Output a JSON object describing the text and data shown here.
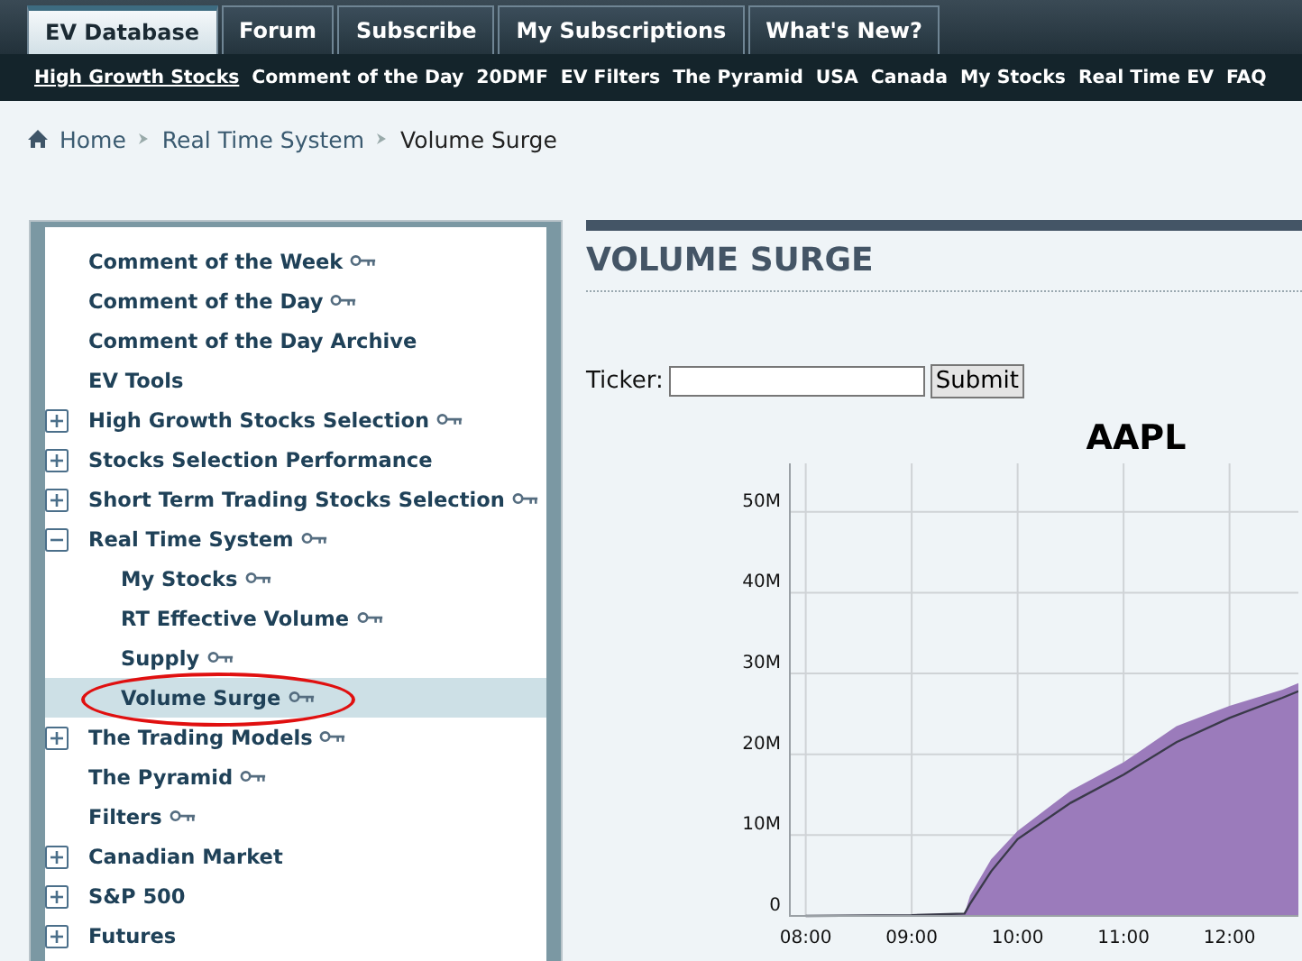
{
  "tabs": [
    {
      "label": "EV Database",
      "selected": true
    },
    {
      "label": "Forum",
      "selected": false
    },
    {
      "label": "Subscribe",
      "selected": false
    },
    {
      "label": "My Subscriptions",
      "selected": false
    },
    {
      "label": "What's New?",
      "selected": false
    }
  ],
  "subnav": [
    {
      "label": "High Growth Stocks",
      "selected": true
    },
    {
      "label": "Comment of the Day",
      "selected": false
    },
    {
      "label": "20DMF",
      "selected": false
    },
    {
      "label": "EV Filters",
      "selected": false
    },
    {
      "label": "The Pyramid",
      "selected": false
    },
    {
      "label": "USA",
      "selected": false
    },
    {
      "label": "Canada",
      "selected": false
    },
    {
      "label": "My Stocks",
      "selected": false
    },
    {
      "label": "Real Time EV",
      "selected": false
    },
    {
      "label": "FAQ",
      "selected": false
    }
  ],
  "breadcrumb": [
    "Home",
    "Real Time System",
    "Volume Surge"
  ],
  "sidebar": {
    "items": [
      {
        "label": "Comment of the Week",
        "locked": true,
        "selected": false
      },
      {
        "label": "Comment of the Day",
        "locked": true,
        "selected": false
      },
      {
        "label": "Comment of the Day Archive",
        "locked": false,
        "selected": false
      },
      {
        "label": "EV Tools",
        "locked": false,
        "selected": false
      },
      {
        "label": "High Growth Stocks Selection",
        "locked": true,
        "expanded": false,
        "selected": false
      },
      {
        "label": "Stocks Selection Performance",
        "locked": false,
        "expanded": false,
        "selected": false
      },
      {
        "label": "Short Term Trading Stocks Selection",
        "locked": true,
        "expanded": false,
        "selected": false
      },
      {
        "label": "Real Time System",
        "locked": true,
        "expanded": true,
        "selected": false,
        "children": [
          {
            "label": "My Stocks",
            "locked": true,
            "selected": false
          },
          {
            "label": "RT Effective Volume",
            "locked": true,
            "selected": false
          },
          {
            "label": "Supply",
            "locked": true,
            "selected": false
          },
          {
            "label": "Volume Surge",
            "locked": true,
            "selected": true
          }
        ]
      },
      {
        "label": "The Trading Models",
        "locked": true,
        "expanded": false,
        "selected": false
      },
      {
        "label": "The Pyramid",
        "locked": true,
        "selected": false
      },
      {
        "label": "Filters",
        "locked": true,
        "selected": false
      },
      {
        "label": "Canadian Market",
        "locked": false,
        "expanded": false,
        "selected": false
      },
      {
        "label": "S&P 500",
        "locked": false,
        "expanded": false,
        "selected": false
      },
      {
        "label": "Futures",
        "locked": false,
        "expanded": false,
        "selected": false
      }
    ]
  },
  "main": {
    "heading": "VOLUME SURGE",
    "ticker_label": "Ticker:",
    "submit": "Submit",
    "chart_data": {
      "type": "area",
      "title": "AAPL",
      "grid": true,
      "x": [
        8,
        9,
        9.5,
        9.55,
        9.75,
        10,
        10.5,
        11,
        11.5,
        12,
        12.5,
        12.65
      ],
      "xlim": [
        7.85,
        12.65
      ],
      "ylim": [
        0,
        56
      ],
      "xticks": [
        {
          "value": 8,
          "label": "08:00"
        },
        {
          "value": 9,
          "label": "09:00"
        },
        {
          "value": 10,
          "label": "10:00"
        },
        {
          "value": 11,
          "label": "11:00"
        },
        {
          "value": 12,
          "label": "12:00"
        }
      ],
      "yticks": [
        {
          "value": 0,
          "label": "0"
        },
        {
          "value": 10,
          "label": "10M"
        },
        {
          "value": 20,
          "label": "20M"
        },
        {
          "value": 30,
          "label": "30M"
        },
        {
          "value": 40,
          "label": "40M"
        },
        {
          "value": 50,
          "label": "50M"
        }
      ],
      "series": [
        {
          "type": "area",
          "color": "#9b7bbb",
          "values": [
            0,
            0.1,
            0.3,
            2.5,
            7,
            10.5,
            15.5,
            19,
            23.5,
            26,
            28,
            28.8
          ]
        },
        {
          "type": "line",
          "color": "#3a3a4a",
          "values": [
            0,
            0.1,
            0.3,
            1.5,
            5.5,
            9.5,
            14,
            17.5,
            21.5,
            24.5,
            27,
            27.8
          ]
        }
      ]
    }
  }
}
